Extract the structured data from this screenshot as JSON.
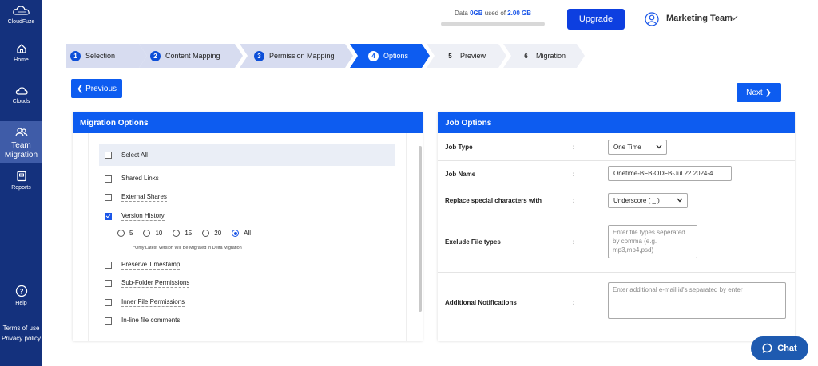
{
  "sidebar": {
    "brand": "CloudFuze",
    "items": [
      {
        "label": "Home",
        "icon": "home-icon"
      },
      {
        "label": "Clouds",
        "icon": "cloud-icon"
      },
      {
        "label": "Team Migration",
        "line1": "Team",
        "line2": "Migration",
        "icon": "team-icon",
        "active": true
      },
      {
        "label": "Reports",
        "icon": "reports-icon"
      },
      {
        "label": "Help",
        "icon": "help-icon"
      }
    ],
    "links": [
      "Terms of use",
      "Privacy policy"
    ]
  },
  "header": {
    "usage_prefix": "Data ",
    "used": "0GB",
    "usage_mid": " used of ",
    "total": "2.00 GB",
    "upgrade_label": "Upgrade",
    "user_name": "Marketing Team"
  },
  "steps": [
    {
      "num": "1",
      "label": "Selection"
    },
    {
      "num": "2",
      "label": "Content Mapping"
    },
    {
      "num": "3",
      "label": "Permission Mapping"
    },
    {
      "num": "4",
      "label": "Options"
    },
    {
      "num": "5",
      "label": "Preview"
    },
    {
      "num": "6",
      "label": "Migration"
    }
  ],
  "nav": {
    "previous": "Previous",
    "next": "Next"
  },
  "migration_options": {
    "title": "Migration Options",
    "select_all": "Select All",
    "options": [
      {
        "label": "Shared Links",
        "checked": false
      },
      {
        "label": "External Shares",
        "checked": false
      },
      {
        "label": "Version History",
        "checked": true
      },
      {
        "label": "Preserve Timestamp",
        "checked": false
      },
      {
        "label": "Sub-Folder Permissions",
        "checked": false
      },
      {
        "label": "Inner File Permissions",
        "checked": false
      },
      {
        "label": "In-line file comments",
        "checked": false
      }
    ],
    "versions": [
      "5",
      "10",
      "15",
      "20",
      "All"
    ],
    "selected_version": "All",
    "version_note": "*Only Latest Version Will Be Migrated in Delta Migration"
  },
  "job_options": {
    "title": "Job Options",
    "colon": ":",
    "job_type_label": "Job Type",
    "job_type_value": "One Time",
    "job_name_label": "Job Name",
    "job_name_value": "Onetime-BFB-ODFB-Jul.22.2024-4",
    "replace_label": "Replace special characters with",
    "replace_value": "Underscore ( _ )",
    "exclude_label": "Exclude File types",
    "exclude_placeholder": "Enter file types seperated by comma (e.g. mp3,mp4,psd)",
    "notify_label": "Additional Notifications",
    "notify_placeholder": "Enter additional e-mail id's separated by enter"
  },
  "chat_label": "Chat",
  "colors": {
    "sidebar": "#14317d",
    "primary": "#0d5cf0",
    "step_done": "#d7dcf0"
  }
}
